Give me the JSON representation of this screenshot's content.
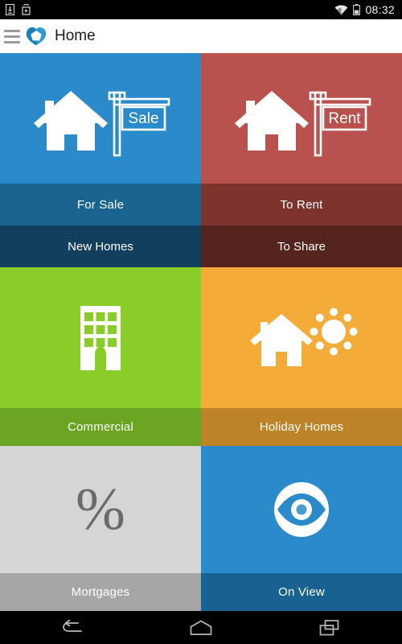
{
  "status_bar": {
    "time": "08:32",
    "left_icons": [
      {
        "name": "download-icon"
      },
      {
        "name": "play-store-icon"
      }
    ],
    "right_icons": [
      {
        "name": "wifi-icon"
      },
      {
        "name": "battery-icon"
      }
    ]
  },
  "app_bar": {
    "menu_icon": "hamburger-menu-icon",
    "logo_icon": "app-logo-icon",
    "title": "Home"
  },
  "colors": {
    "for_sale": "#2b8bca",
    "for_sale_label": "#1a6492",
    "new_homes_label": "#133f5e",
    "to_rent": "#b9524e",
    "to_rent_label": "#7e332e",
    "to_share_label": "#55241f",
    "commercial": "#8bcd28",
    "commercial_label": "#6ba421",
    "holiday_homes": "#f4ab37",
    "holiday_homes_label": "#bd8326",
    "mortgages": "#d5d5d5",
    "mortgages_label": "#a6a6a6",
    "on_view": "#2b8bca",
    "on_view_label": "#176291",
    "icon_white": "#ffffff",
    "percent_grey": "#6b6b6b"
  },
  "tiles": [
    {
      "id": "for-sale",
      "label": "For Sale",
      "sub_label": "New Homes",
      "icon": "house-for-sale-sign-icon",
      "sign_text": "Sale"
    },
    {
      "id": "to-rent",
      "label": "To Rent",
      "sub_label": "To Share",
      "icon": "house-for-rent-sign-icon",
      "sign_text": "Rent"
    },
    {
      "id": "commercial",
      "label": "Commercial",
      "icon": "office-building-icon"
    },
    {
      "id": "holiday-homes",
      "label": "Holiday Homes",
      "icon": "house-with-sun-icon"
    },
    {
      "id": "mortgages",
      "label": "Mortgages",
      "icon": "percent-icon",
      "glyph": "%"
    },
    {
      "id": "on-view",
      "label": "On View",
      "icon": "eye-icon"
    }
  ],
  "nav_bar": {
    "buttons": [
      {
        "name": "back-button"
      },
      {
        "name": "home-button"
      },
      {
        "name": "recents-button"
      }
    ]
  }
}
